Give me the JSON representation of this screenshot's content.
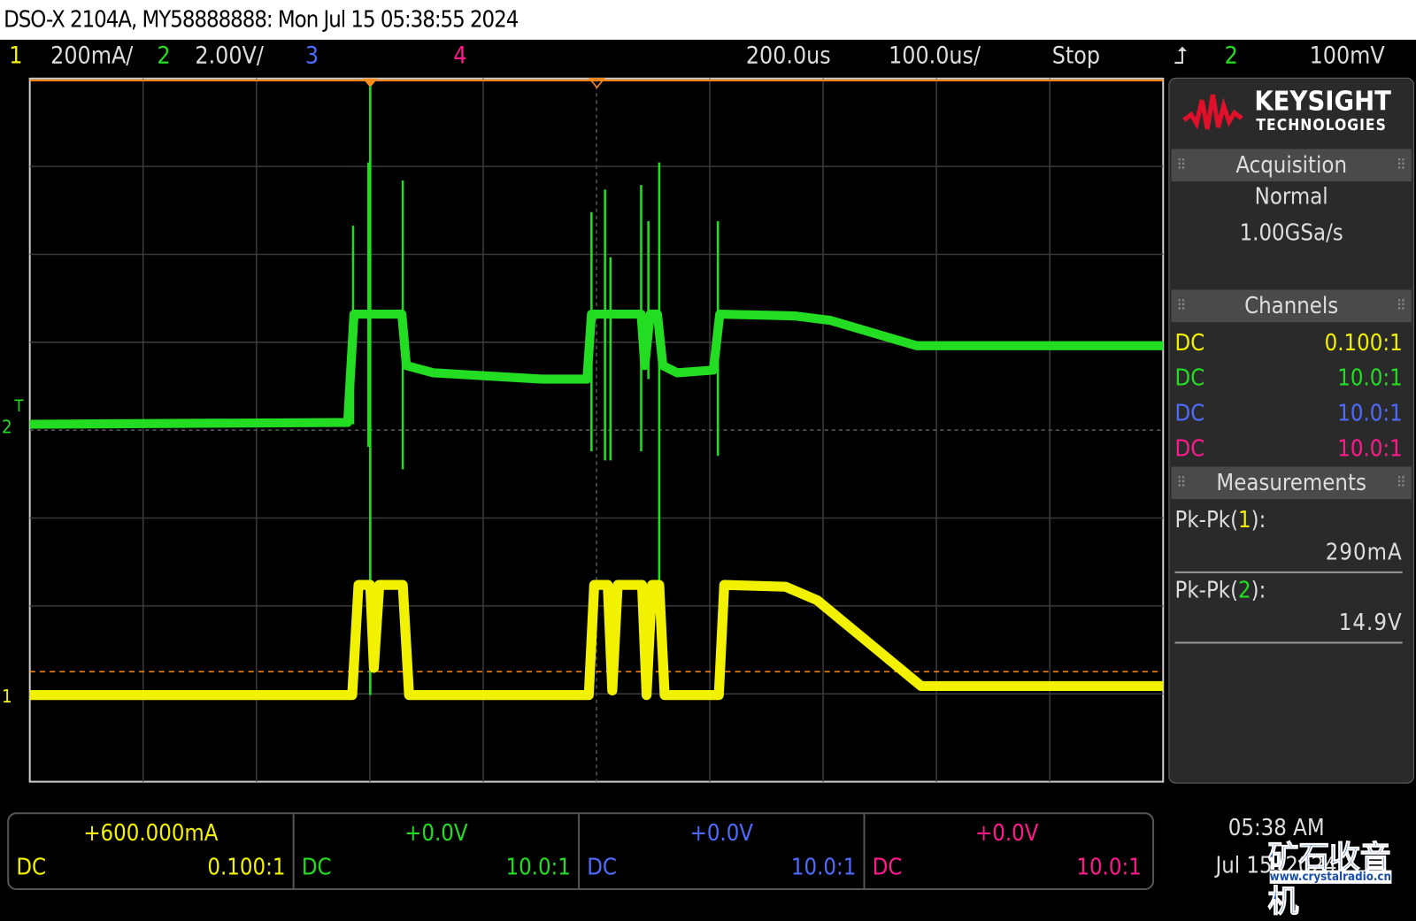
{
  "title": "DSO-X 2104A, MY58888888: Mon Jul 15 05:38:55 2024",
  "status": {
    "ch1": {
      "num": "1",
      "scale": "200mA/",
      "color": "#f2f200"
    },
    "ch2": {
      "num": "2",
      "scale": "2.00V/",
      "color": "#22dd22"
    },
    "ch3": {
      "num": "3",
      "color": "#4f6bff"
    },
    "ch4": {
      "num": "4",
      "color": "#ff1a8c"
    },
    "delay": "200.0us",
    "timebase": "100.0us/",
    "run_state": "Stop",
    "trigger_icon": "rising-edge-icon",
    "trigger_source": "2",
    "trigger_level": "100mV"
  },
  "side": {
    "brand": "KEYSIGHT",
    "brand_sub": "TECHNOLOGIES",
    "acquisition": {
      "header": "Acquisition",
      "mode": "Normal",
      "rate": "1.00GSa/s"
    },
    "channels": {
      "header": "Channels",
      "rows": [
        {
          "coupling": "DC",
          "probe": "0.100:1",
          "color": "#f2f200"
        },
        {
          "coupling": "DC",
          "probe": "10.0:1",
          "color": "#22dd22"
        },
        {
          "coupling": "DC",
          "probe": "10.0:1",
          "color": "#4f6bff"
        },
        {
          "coupling": "DC",
          "probe": "10.0:1",
          "color": "#ff1a8c"
        }
      ]
    },
    "measurements": {
      "header": "Measurements",
      "items": [
        {
          "label": "Pk-Pk(",
          "ch": "1",
          "close": "):",
          "value": "290mA",
          "color": "#f2f200"
        },
        {
          "label": "Pk-Pk(",
          "ch": "2",
          "close": "):",
          "value": "14.9V",
          "color": "#22dd22"
        }
      ]
    }
  },
  "bottom": [
    {
      "offset": "+600.000mA",
      "coupling": "DC",
      "probe": "0.100:1",
      "color": "#f2f200"
    },
    {
      "offset": "+0.0V",
      "coupling": "DC",
      "probe": "10.0:1",
      "color": "#22dd22"
    },
    {
      "offset": "+0.0V",
      "coupling": "DC",
      "probe": "10.0:1",
      "color": "#4f6bff"
    },
    {
      "offset": "+0.0V",
      "coupling": "DC",
      "probe": "10.0:1",
      "color": "#ff1a8c"
    }
  ],
  "clock": {
    "time": "05:38 AM",
    "date": "Jul 15, 2024"
  },
  "watermark": {
    "text": "矿石收音机",
    "url": "www.crystalradio.cn"
  },
  "markers": {
    "ch1": "1",
    "ch2": "2",
    "trigger": "T"
  }
}
